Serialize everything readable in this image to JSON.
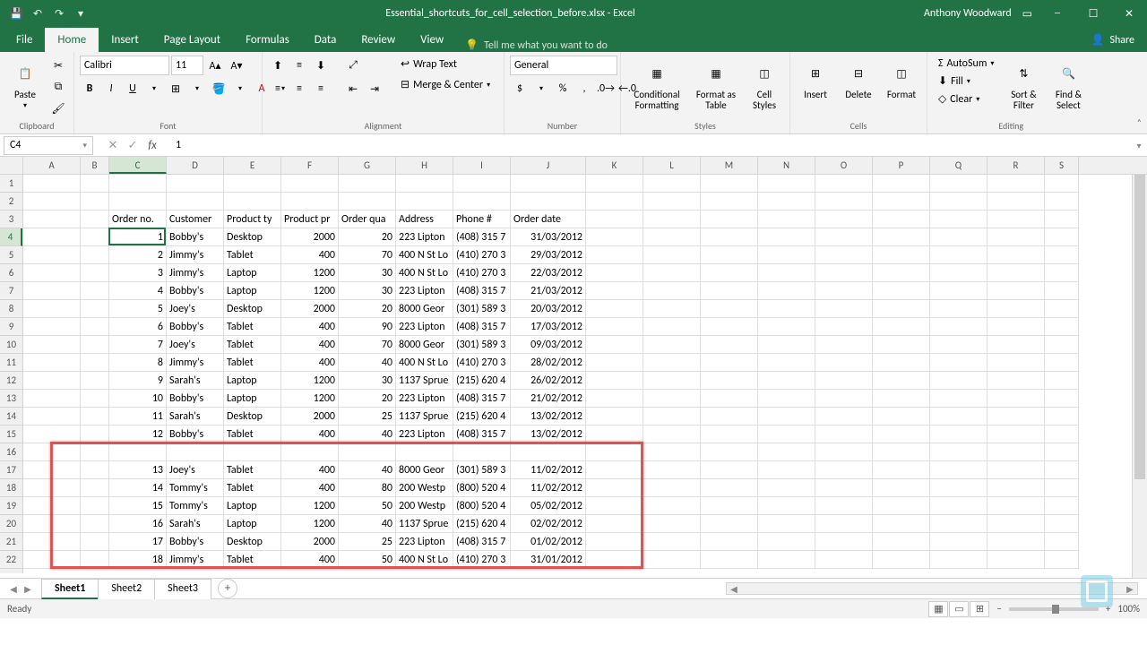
{
  "titlebar": {
    "title": "Essential_shortcuts_for_cell_selection_before.xlsx - Excel",
    "user": "Anthony Woodward"
  },
  "tabs": {
    "file": "File",
    "home": "Home",
    "insert": "Insert",
    "page_layout": "Page Layout",
    "formulas": "Formulas",
    "data": "Data",
    "review": "Review",
    "view": "View",
    "tell_me": "Tell me what you want to do",
    "share": "Share"
  },
  "ribbon": {
    "clipboard": {
      "label": "Clipboard",
      "paste": "Paste"
    },
    "font": {
      "label": "Font",
      "name": "Calibri",
      "size": "11",
      "bold": "B",
      "italic": "I",
      "underline": "U"
    },
    "alignment": {
      "label": "Alignment",
      "wrap": "Wrap Text",
      "merge": "Merge & Center"
    },
    "number": {
      "label": "Number",
      "format": "General"
    },
    "styles": {
      "label": "Styles",
      "cond": "Conditional Formatting",
      "table": "Format as Table",
      "cell": "Cell Styles"
    },
    "cells": {
      "label": "Cells",
      "insert": "Insert",
      "delete": "Delete",
      "format": "Format"
    },
    "editing": {
      "label": "Editing",
      "autosum": "AutoSum",
      "fill": "Fill",
      "clear": "Clear",
      "sort": "Sort & Filter",
      "find": "Find & Select"
    }
  },
  "namebox": "C4",
  "formula": "1",
  "columns": [
    "A",
    "B",
    "C",
    "D",
    "E",
    "F",
    "G",
    "H",
    "I",
    "J",
    "K",
    "L",
    "M",
    "N",
    "O",
    "P",
    "Q",
    "R",
    "S"
  ],
  "headers": {
    "c": "Order no.",
    "d": "Customer",
    "e": "Product ty",
    "f": "Product pr",
    "g": "Order qua",
    "h": "Address",
    "i": "Phone #",
    "j": "Order date"
  },
  "rows": [
    {
      "n": "1",
      "cust": "Bobby's",
      "prod": "Desktop",
      "price": "2000",
      "qty": "20",
      "addr": "223 Lipton",
      "phone": "(408) 315 7",
      "date": "31/03/2012"
    },
    {
      "n": "2",
      "cust": "Jimmy's",
      "prod": "Tablet",
      "price": "400",
      "qty": "70",
      "addr": "400 N St Lo",
      "phone": "(410) 270 3",
      "date": "29/03/2012"
    },
    {
      "n": "3",
      "cust": "Jimmy's",
      "prod": "Laptop",
      "price": "1200",
      "qty": "30",
      "addr": "400 N St Lo",
      "phone": "(410) 270 3",
      "date": "22/03/2012"
    },
    {
      "n": "4",
      "cust": "Bobby's",
      "prod": "Laptop",
      "price": "1200",
      "qty": "30",
      "addr": "223 Lipton",
      "phone": "(408) 315 7",
      "date": "21/03/2012"
    },
    {
      "n": "5",
      "cust": "Joey's",
      "prod": "Desktop",
      "price": "2000",
      "qty": "20",
      "addr": "8000 Geor",
      "phone": "(301) 589 3",
      "date": "20/03/2012"
    },
    {
      "n": "6",
      "cust": "Bobby's",
      "prod": "Tablet",
      "price": "400",
      "qty": "90",
      "addr": "223 Lipton",
      "phone": "(408) 315 7",
      "date": "17/03/2012"
    },
    {
      "n": "7",
      "cust": "Joey's",
      "prod": "Tablet",
      "price": "400",
      "qty": "70",
      "addr": "8000 Geor",
      "phone": "(301) 589 3",
      "date": "09/03/2012"
    },
    {
      "n": "8",
      "cust": "Jimmy's",
      "prod": "Tablet",
      "price": "400",
      "qty": "40",
      "addr": "400 N St Lo",
      "phone": "(410) 270 3",
      "date": "28/02/2012"
    },
    {
      "n": "9",
      "cust": "Sarah's",
      "prod": "Laptop",
      "price": "1200",
      "qty": "30",
      "addr": "1137 Sprue",
      "phone": "(215) 620 4",
      "date": "26/02/2012"
    },
    {
      "n": "10",
      "cust": "Bobby's",
      "prod": "Laptop",
      "price": "1200",
      "qty": "20",
      "addr": "223 Lipton",
      "phone": "(408) 315 7",
      "date": "21/02/2012"
    },
    {
      "n": "11",
      "cust": "Sarah's",
      "prod": "Desktop",
      "price": "2000",
      "qty": "25",
      "addr": "1137 Sprue",
      "phone": "(215) 620 4",
      "date": "13/02/2012"
    },
    {
      "n": "12",
      "cust": "Bobby's",
      "prod": "Tablet",
      "price": "400",
      "qty": "40",
      "addr": "223 Lipton",
      "phone": "(408) 315 7",
      "date": "13/02/2012"
    },
    null,
    {
      "n": "13",
      "cust": "Joey's",
      "prod": "Tablet",
      "price": "400",
      "qty": "40",
      "addr": "8000 Geor",
      "phone": "(301) 589 3",
      "date": "11/02/2012"
    },
    {
      "n": "14",
      "cust": "Tommy's",
      "prod": "Tablet",
      "price": "400",
      "qty": "80",
      "addr": "200 Westp",
      "phone": "(800) 520 4",
      "date": "11/02/2012"
    },
    {
      "n": "15",
      "cust": "Tommy's",
      "prod": "Laptop",
      "price": "1200",
      "qty": "50",
      "addr": "200 Westp",
      "phone": "(800) 520 4",
      "date": "05/02/2012"
    },
    {
      "n": "16",
      "cust": "Sarah's",
      "prod": "Laptop",
      "price": "1200",
      "qty": "40",
      "addr": "1137 Sprue",
      "phone": "(215) 620 4",
      "date": "02/02/2012"
    },
    {
      "n": "17",
      "cust": "Bobby's",
      "prod": "Desktop",
      "price": "2000",
      "qty": "25",
      "addr": "223 Lipton",
      "phone": "(408) 315 7",
      "date": "01/02/2012"
    },
    {
      "n": "18",
      "cust": "Jimmy's",
      "prod": "Tablet",
      "price": "400",
      "qty": "50",
      "addr": "400 N St Lo",
      "phone": "(410) 270 3",
      "date": "31/01/2012"
    }
  ],
  "sheets": {
    "s1": "Sheet1",
    "s2": "Sheet2",
    "s3": "Sheet3"
  },
  "status": {
    "ready": "Ready",
    "zoom": "100%"
  }
}
